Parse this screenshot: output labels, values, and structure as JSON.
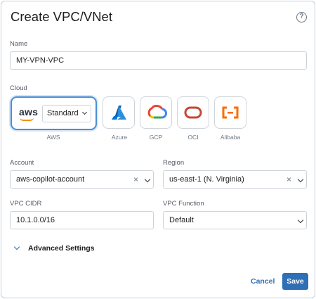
{
  "dialog": {
    "title": "Create VPC/VNet",
    "help_icon": "?"
  },
  "name": {
    "label": "Name",
    "value": "MY-VPN-VPC"
  },
  "cloud": {
    "label": "Cloud",
    "selected": "AWS",
    "aws_logo_text": "aws",
    "aws_edition": "Standard",
    "providers": [
      {
        "label": "AWS",
        "icon": "aws-icon"
      },
      {
        "label": "Azure",
        "icon": "azure-icon"
      },
      {
        "label": "GCP",
        "icon": "gcp-icon"
      },
      {
        "label": "OCI",
        "icon": "oci-icon"
      },
      {
        "label": "Alibaba",
        "icon": "alibaba-icon"
      }
    ]
  },
  "account": {
    "label": "Account",
    "value": "aws-copilot-account"
  },
  "region": {
    "label": "Region",
    "value": "us-east-1 (N. Virginia)"
  },
  "vpc_cidr": {
    "label": "VPC CIDR",
    "value": "10.1.0.0/16"
  },
  "vpc_function": {
    "label": "VPC Function",
    "value": "Default"
  },
  "advanced": {
    "label": "Advanced Settings"
  },
  "footer": {
    "cancel_label": "Cancel",
    "save_label": "Save"
  },
  "colors": {
    "accent": "#2f6fb5",
    "selected_border": "#4a8fd6",
    "azure": "#0078d4",
    "oci": "#c74634",
    "alibaba": "#ff6a00"
  }
}
